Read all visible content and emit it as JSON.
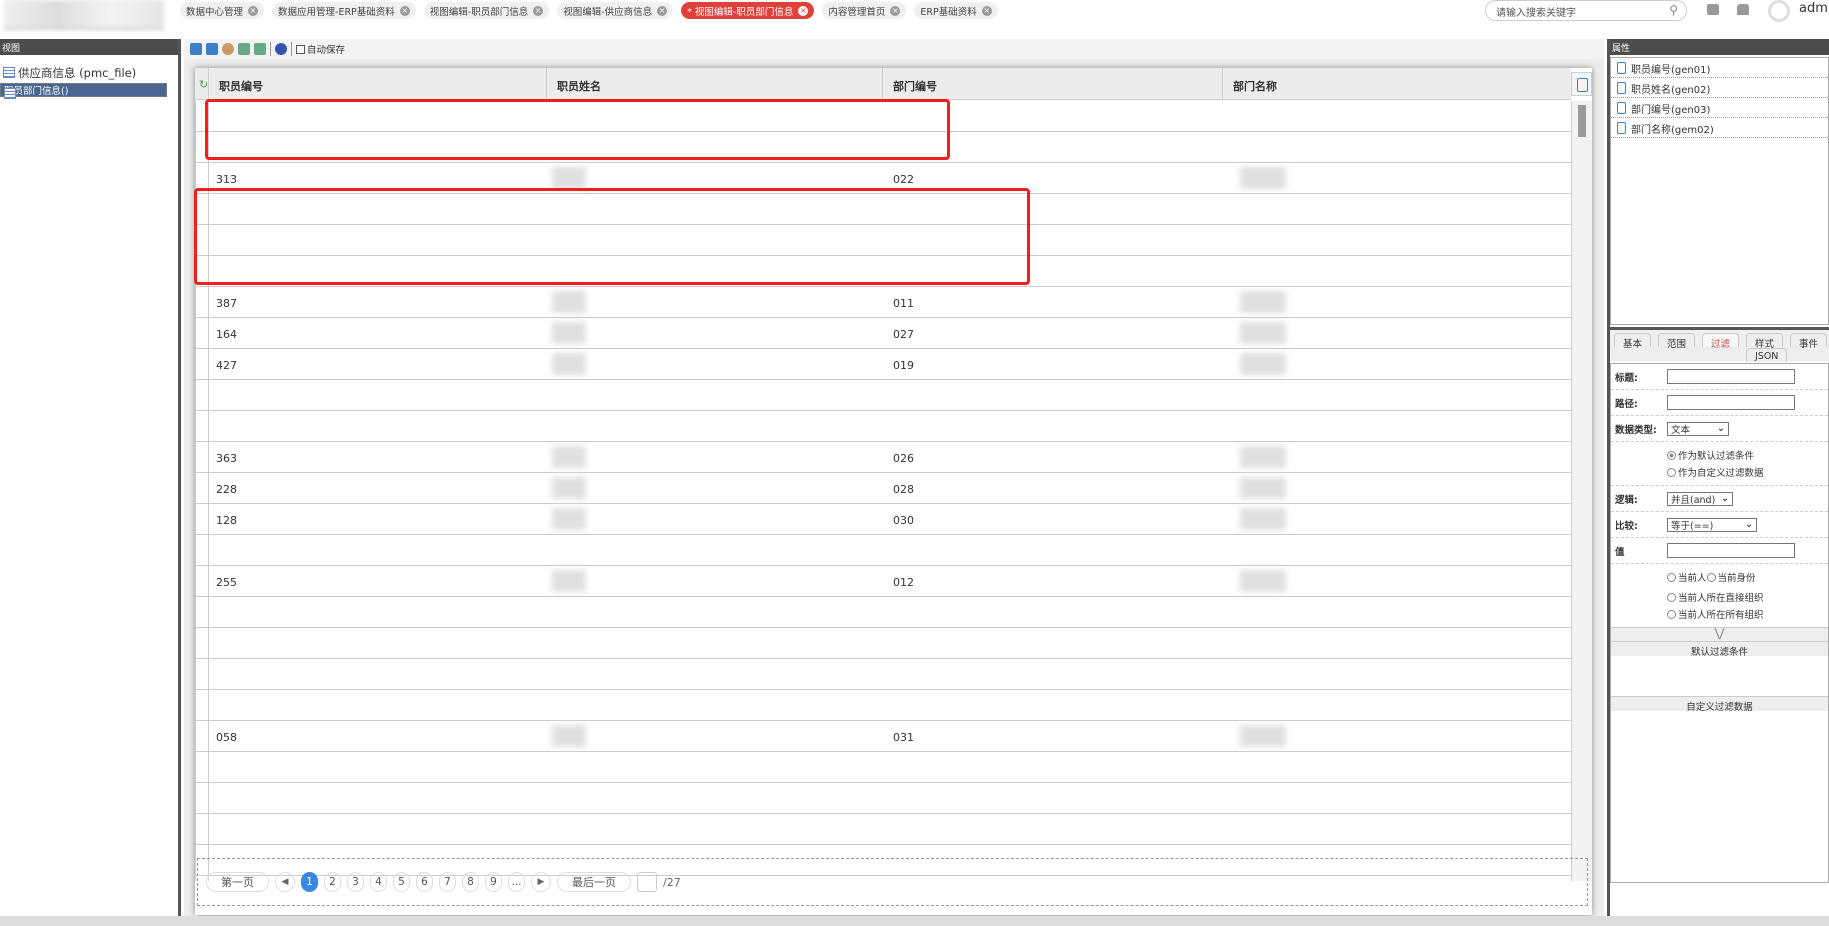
{
  "header": {
    "tabs": [
      {
        "label": "数据中心管理",
        "active": false
      },
      {
        "label": "数据应用管理-ERP基础资料",
        "active": false
      },
      {
        "label": "视图编辑-职员部门信息",
        "active": false
      },
      {
        "label": "视图编辑-供应商信息",
        "active": false
      },
      {
        "label": "* 视图编辑-职员部门信息",
        "active": true
      },
      {
        "label": "内容管理首页",
        "active": false
      },
      {
        "label": "ERP基础资料",
        "active": false
      }
    ],
    "search_placeholder": "请输入搜索关键字",
    "user": "admin"
  },
  "left_panel": {
    "title": "视图",
    "items": [
      {
        "label": "供应商信息 (pmc_file)",
        "selected": false
      },
      {
        "label": "职员部门信息()",
        "selected": true
      }
    ]
  },
  "toolbar": {
    "autosave_label": "自动保存",
    "autosave_checked": false
  },
  "grid": {
    "columns": [
      "职员编号",
      "职员姓名",
      "部门编号",
      "部门名称"
    ],
    "rows": [
      [
        "",
        ""
      ],
      [
        "",
        ""
      ],
      [
        "313",
        "022"
      ],
      [
        "",
        ""
      ],
      [
        "",
        ""
      ],
      [
        "",
        ""
      ],
      [
        "387",
        "011"
      ],
      [
        "164",
        "027"
      ],
      [
        "427",
        "019"
      ],
      [
        "",
        ""
      ],
      [
        "",
        ""
      ],
      [
        "363",
        "026"
      ],
      [
        "228",
        "028"
      ],
      [
        "128",
        "030"
      ],
      [
        "",
        ""
      ],
      [
        "255",
        "012"
      ],
      [
        "",
        ""
      ],
      [
        "",
        ""
      ],
      [
        "",
        ""
      ],
      [
        "",
        ""
      ],
      [
        "058",
        "031"
      ],
      [
        "",
        ""
      ],
      [
        "",
        ""
      ],
      [
        "",
        ""
      ],
      [
        "",
        ""
      ]
    ]
  },
  "pager": {
    "first": "第一页",
    "last": "最后一页",
    "pages": [
      "1",
      "2",
      "3",
      "4",
      "5",
      "6",
      "7",
      "8",
      "9",
      "..."
    ],
    "current": "1",
    "total": "/27"
  },
  "right_panel": {
    "title": "属性",
    "fields": [
      "职员编号(gen01)",
      "职员姓名(gen02)",
      "部门编号(gen03)",
      "部门名称(gem02)"
    ],
    "tabs": [
      "基本",
      "范围",
      "过滤",
      "样式",
      "事件",
      "JSON"
    ],
    "active_tab": "过滤",
    "form": {
      "title_label": "标题:",
      "path_label": "路径:",
      "datatype_label": "数据类型:",
      "datatype_value": "文本",
      "radio_default": "作为默认过滤条件",
      "radio_custom": "作为自定义过滤数据",
      "logic_label": "逻辑:",
      "logic_value": "并且(and)",
      "compare_label": "比较:",
      "compare_value": "等于(==)",
      "value_label": "值",
      "opt_current_person": "当前人",
      "opt_current_identity": "当前身份",
      "opt_direct_org": "当前人所在直接组织",
      "opt_all_org": "当前人所在所有组织",
      "section_default": "默认过滤条件",
      "section_custom": "自定义过滤数据"
    }
  },
  "colors": {
    "accent": "#e0403a",
    "selected": "#4a6591",
    "page_current": "#3a87e0",
    "highlight_box": "#f01f1f"
  }
}
